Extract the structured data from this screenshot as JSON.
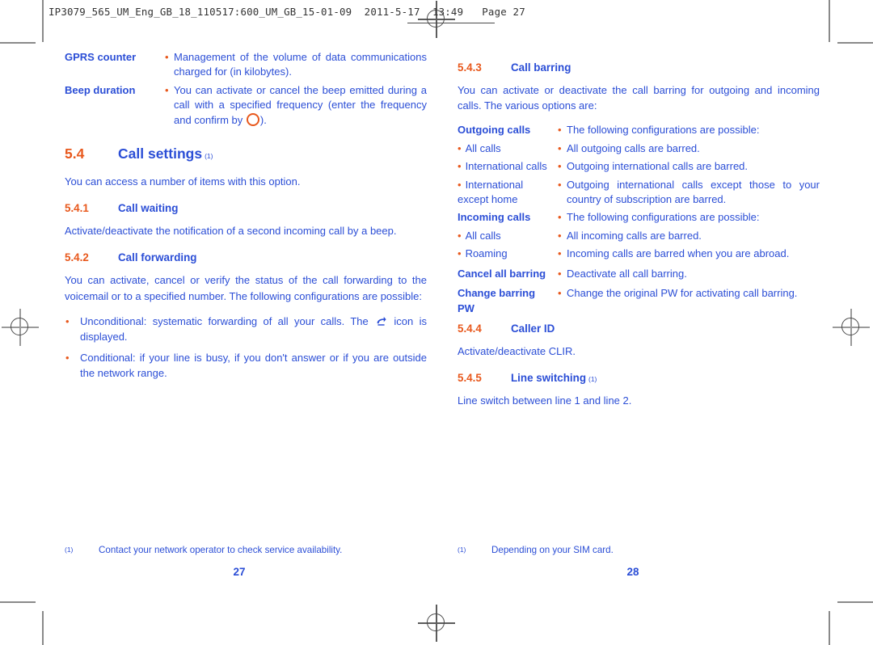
{
  "header": {
    "filename": "IP3079_565_UM_Eng_GB_18_110517:600_UM_GB_15-01-09",
    "date": "2011-5-17",
    "time": "13:49",
    "page_label": "Page 27"
  },
  "colors": {
    "heading_number": "#e8581c",
    "heading_title": "#2b4ed6",
    "body_text": "#2b4ed6",
    "bullet": "#e8581c"
  },
  "left_page": {
    "intro_rows": [
      {
        "label": "GPRS counter",
        "bullet": "•",
        "text": "Management of the volume of data communications charged for (in kilobytes)."
      },
      {
        "label": "Beep duration",
        "bullet": "•",
        "text_before": "You can activate or cancel the beep emitted during a call with a specified frequency (enter the frequency and confirm by ",
        "icon": "ok-key-circle-icon",
        "text_after": ")."
      }
    ],
    "section": {
      "number": "5.4",
      "title": "Call settings",
      "footnote_marker": "(1)"
    },
    "section_intro": "You can access a number of items with this option.",
    "subsections": [
      {
        "number": "5.4.1",
        "title": "Call waiting",
        "body": "Activate/deactivate the notification of a second incoming call by a beep."
      },
      {
        "number": "5.4.2",
        "title": "Call forwarding",
        "body": "You can activate, cancel or verify the status of the call forwarding to the voicemail or to a specified number. The following configurations are possible:",
        "bullets": [
          {
            "mark": "•",
            "text_before": "Unconditional: systematic forwarding of all your calls. The ",
            "icon": "call-forwarding-icon",
            "text_after": " icon is displayed."
          },
          {
            "mark": "•",
            "text": "Conditional: if your line is busy, if you don't answer or if you are outside the network range."
          }
        ]
      }
    ],
    "footnote": {
      "marker": "(1)",
      "text": "Contact your network operator to check service availability."
    },
    "folio": "27"
  },
  "right_page": {
    "subsections": [
      {
        "number": "5.4.3",
        "title": "Call barring",
        "body": "You can activate or deactivate the call barring for outgoing and incoming calls. The various options are:",
        "rows": [
          {
            "label": "Outgoing calls",
            "label_bold": true,
            "label_bullet": false,
            "bullet": "•",
            "text": "The following configurations are possible:"
          },
          {
            "label": "All calls",
            "label_bold": false,
            "label_bullet": true,
            "bullet": "•",
            "text": "All outgoing calls are barred."
          },
          {
            "label": "International calls",
            "label_bold": false,
            "label_bullet": true,
            "bullet": "•",
            "text": "Outgoing international calls are barred."
          },
          {
            "label": "International except home",
            "label_bold": false,
            "label_bullet": true,
            "bullet": "•",
            "text": "Outgoing international calls except those to your country of subscription are barred."
          },
          {
            "label": "Incoming calls",
            "label_bold": true,
            "label_bullet": false,
            "bullet": "•",
            "text": "The following configurations are possible:"
          },
          {
            "label": "All calls",
            "label_bold": false,
            "label_bullet": true,
            "bullet": "•",
            "text": "All incoming calls are barred."
          },
          {
            "label": "Roaming",
            "label_bold": false,
            "label_bullet": true,
            "bullet": "•",
            "text": "Incoming calls are barred when you are abroad."
          },
          {
            "label": "Cancel all barring",
            "label_bold": true,
            "label_bullet": false,
            "bullet": "•",
            "text": "Deactivate all call barring."
          },
          {
            "label": "Change barring PW",
            "label_bold": true,
            "label_bullet": false,
            "bullet": "•",
            "text": "Change the original PW for activating call barring."
          }
        ]
      },
      {
        "number": "5.4.4",
        "title": "Caller ID",
        "body": "Activate/deactivate CLIR."
      },
      {
        "number": "5.4.5",
        "title": "Line switching",
        "footnote_marker": "(1)",
        "body": "Line switch between line 1 and line 2."
      }
    ],
    "footnote": {
      "marker": "(1)",
      "text": "Depending on your SIM card."
    },
    "folio": "28"
  }
}
